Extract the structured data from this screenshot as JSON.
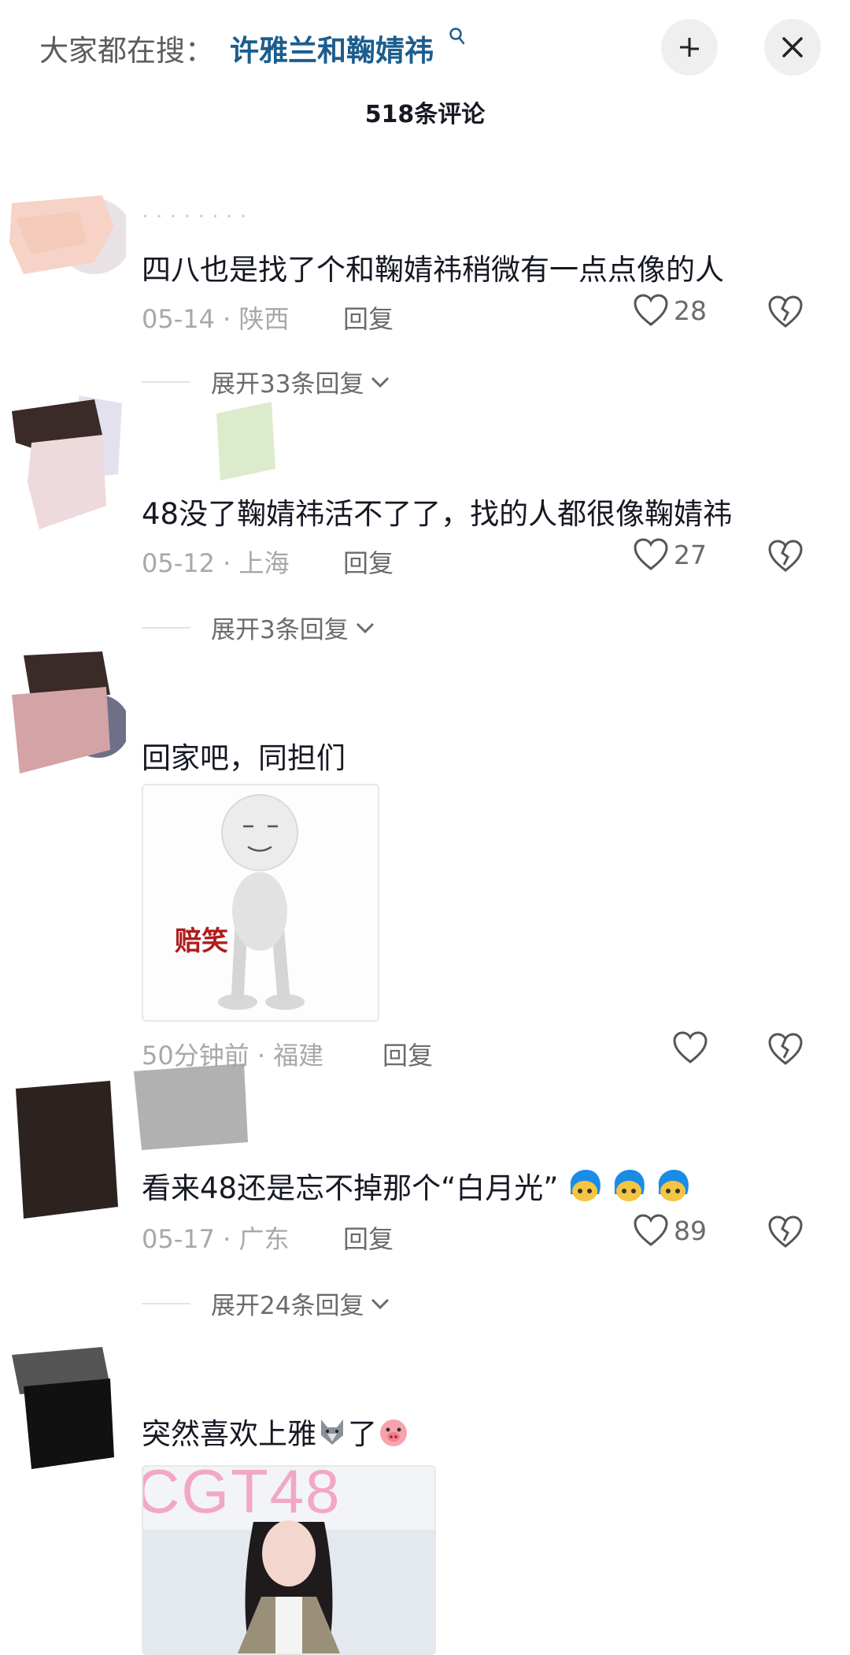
{
  "header": {
    "search_prefix": "大家都在搜：",
    "search_term": "许雅兰和鞠婧祎",
    "comment_count": "518条评论",
    "minimize_icon": "minimize-icon",
    "close_icon": "close-icon"
  },
  "comments": [
    {
      "text": "四八也是找了个和鞠婧祎稍微有一点点像的人",
      "date": "05-14",
      "location": "陕西",
      "reply_label": "回复",
      "likes": "28",
      "expand": "展开33条回复"
    },
    {
      "text": "48没了鞠婧祎活不了了，找的人都很像鞠婧祎",
      "date": "05-12",
      "location": "上海",
      "reply_label": "回复",
      "likes": "27",
      "expand": "展开3条回复"
    },
    {
      "text": "回家吧，同担们",
      "image_caption": "赔笑",
      "date": "50分钟前",
      "location": "福建",
      "reply_label": "回复",
      "likes": ""
    },
    {
      "text": "看来48还是忘不掉那个“白月光”",
      "date": "05-17",
      "location": "广东",
      "reply_label": "回复",
      "likes": "89",
      "expand": "展开24条回复"
    },
    {
      "text_before": "突然喜欢上雅",
      "text_after": "了",
      "image_text": "CGT48"
    }
  ],
  "colors": {
    "accent": "#1c5d8e",
    "meta": "#a8a8a8",
    "text": "#161823"
  }
}
